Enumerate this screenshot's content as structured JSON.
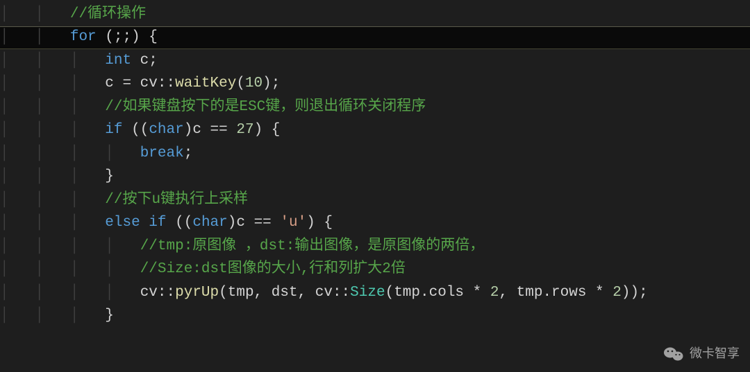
{
  "code": {
    "lines": [
      {
        "indent": 2,
        "tokens": [
          {
            "type": "comment",
            "text": "//循环操作"
          }
        ],
        "highlighted": false
      },
      {
        "indent": 2,
        "tokens": [
          {
            "type": "keyword",
            "text": "for"
          },
          {
            "type": "plain",
            "text": " "
          },
          {
            "type": "paren",
            "text": "(;;)"
          },
          {
            "type": "plain",
            "text": " "
          },
          {
            "type": "brace",
            "text": "{"
          }
        ],
        "highlighted": true
      },
      {
        "indent": 3,
        "tokens": [
          {
            "type": "type",
            "text": "int"
          },
          {
            "type": "plain",
            "text": " c;"
          }
        ],
        "highlighted": false
      },
      {
        "indent": 3,
        "tokens": [
          {
            "type": "plain",
            "text": "c = cv::"
          },
          {
            "type": "function",
            "text": "waitKey"
          },
          {
            "type": "paren",
            "text": "("
          },
          {
            "type": "number",
            "text": "10"
          },
          {
            "type": "paren",
            "text": ")"
          },
          {
            "type": "plain",
            "text": ";"
          }
        ],
        "highlighted": false
      },
      {
        "indent": 3,
        "tokens": [
          {
            "type": "comment",
            "text": "//如果键盘按下的是ESC键，则退出循环关闭程序"
          }
        ],
        "highlighted": false
      },
      {
        "indent": 3,
        "tokens": [
          {
            "type": "keyword",
            "text": "if"
          },
          {
            "type": "plain",
            "text": " "
          },
          {
            "type": "paren",
            "text": "(("
          },
          {
            "type": "type",
            "text": "char"
          },
          {
            "type": "paren",
            "text": ")"
          },
          {
            "type": "plain",
            "text": "c == "
          },
          {
            "type": "number",
            "text": "27"
          },
          {
            "type": "paren",
            "text": ")"
          },
          {
            "type": "plain",
            "text": " "
          },
          {
            "type": "brace",
            "text": "{"
          }
        ],
        "highlighted": false
      },
      {
        "indent": 4,
        "tokens": [
          {
            "type": "keyword",
            "text": "break"
          },
          {
            "type": "plain",
            "text": ";"
          }
        ],
        "highlighted": false
      },
      {
        "indent": 3,
        "tokens": [
          {
            "type": "brace",
            "text": "}"
          }
        ],
        "highlighted": false
      },
      {
        "indent": 3,
        "tokens": [
          {
            "type": "comment",
            "text": "//按下u键执行上采样"
          }
        ],
        "highlighted": false
      },
      {
        "indent": 3,
        "tokens": [
          {
            "type": "keyword",
            "text": "else"
          },
          {
            "type": "plain",
            "text": " "
          },
          {
            "type": "keyword",
            "text": "if"
          },
          {
            "type": "plain",
            "text": " "
          },
          {
            "type": "paren",
            "text": "(("
          },
          {
            "type": "type",
            "text": "char"
          },
          {
            "type": "paren",
            "text": ")"
          },
          {
            "type": "plain",
            "text": "c == "
          },
          {
            "type": "char",
            "text": "'u'"
          },
          {
            "type": "paren",
            "text": ")"
          },
          {
            "type": "plain",
            "text": " "
          },
          {
            "type": "brace",
            "text": "{"
          }
        ],
        "highlighted": false
      },
      {
        "indent": 4,
        "tokens": [
          {
            "type": "comment",
            "text": "//tmp:原图像 ，dst:输出图像，是原图像的两倍，"
          }
        ],
        "highlighted": false
      },
      {
        "indent": 4,
        "tokens": [
          {
            "type": "comment",
            "text": "//Size:dst图像的大小,行和列扩大2倍"
          }
        ],
        "highlighted": false
      },
      {
        "indent": 4,
        "tokens": [
          {
            "type": "plain",
            "text": "cv::"
          },
          {
            "type": "function",
            "text": "pyrUp"
          },
          {
            "type": "paren",
            "text": "("
          },
          {
            "type": "plain",
            "text": "tmp, dst, cv::"
          },
          {
            "type": "classname",
            "text": "Size"
          },
          {
            "type": "paren",
            "text": "("
          },
          {
            "type": "plain",
            "text": "tmp.cols * "
          },
          {
            "type": "number",
            "text": "2"
          },
          {
            "type": "plain",
            "text": ", tmp.rows * "
          },
          {
            "type": "number",
            "text": "2"
          },
          {
            "type": "paren",
            "text": "))"
          },
          {
            "type": "plain",
            "text": ";"
          }
        ],
        "highlighted": false
      },
      {
        "indent": 3,
        "tokens": [
          {
            "type": "brace",
            "text": "}"
          }
        ],
        "highlighted": false
      }
    ]
  },
  "watermark": {
    "text": "微卡智享"
  }
}
